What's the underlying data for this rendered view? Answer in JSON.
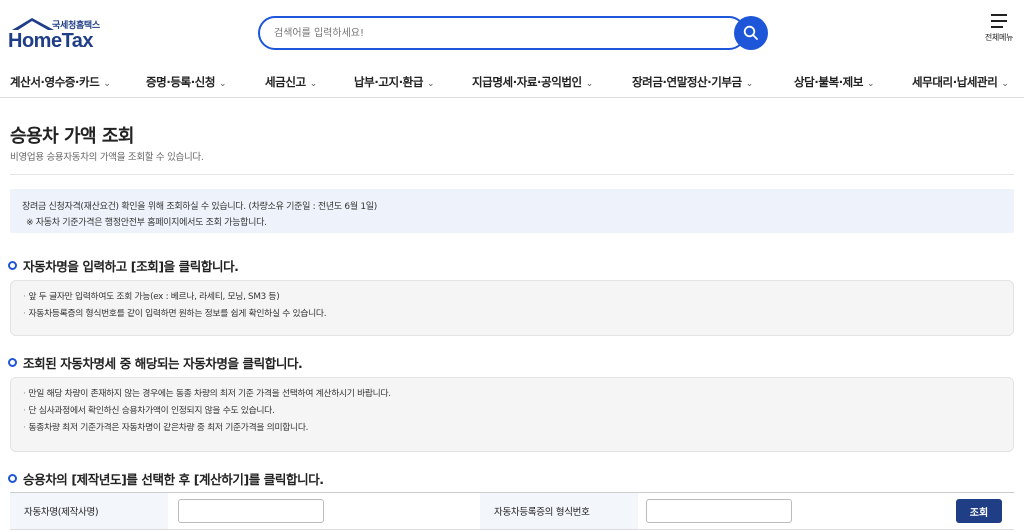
{
  "header": {
    "logo_sub": "국세청홈택스",
    "logo_main": "HomeTax",
    "search_placeholder": "검색어를 입력하세요!",
    "allmenu_label": "전체메뉴"
  },
  "nav": {
    "items": [
      {
        "label": "계산서·영수증·카드"
      },
      {
        "label": "증명·등록·신청"
      },
      {
        "label": "세금신고"
      },
      {
        "label": "납부·고지·환급"
      },
      {
        "label": "지급명세·자료·공익법인"
      },
      {
        "label": "장려금·연말정산·기부금"
      },
      {
        "label": "상담·불복·제보"
      },
      {
        "label": "세무대리·납세관리"
      }
    ]
  },
  "page": {
    "title": "승용차 가액 조회",
    "description": "비영업용 승용자동차의 가액을 조회할 수 있습니다."
  },
  "info": {
    "line1": "장려금 신청자격(재산요건) 확인을 위해 조회하실 수 있습니다. (차량소유 기준일 : 전년도 6월 1일)",
    "line2": "※ 자동차 기준가격은 행정안전부 홈페이지에서도 조회 가능합니다."
  },
  "sections": [
    {
      "title": "자동차명을 입력하고 [조회]을 클릭합니다.",
      "notes": [
        "앞 두 글자만 입력하여도 조회 가능(ex : 베르나, 라세티, 모닝, SM3 등)",
        "자동차등록증의 형식번호를 같이 입력하면 원하는 정보를 쉽게 확인하실 수 있습니다."
      ]
    },
    {
      "title": "조회된 자동차명세 중 해당되는 자동차명을 클릭합니다.",
      "notes": [
        "만일 해당 차량이 존재하지 않는 경우에는 동종 차량의 최저 기준 가격을 선택하여 계산하시기 바랍니다.",
        "단 심사과정에서 확인하신 승용차가액이 인정되지 않을 수도 있습니다.",
        "동종차량 최저 기준가격은 자동차명이 같은차량 중  최저 기준가격을 의미합니다."
      ]
    },
    {
      "title": "승용차의 [제작년도]를 선택한 후 [계산하기]를 클릭합니다."
    }
  ],
  "form": {
    "car_name_label": "자동차명(제작사명)",
    "car_name_value": "",
    "type_number_label": "자동차등록증의 형식번호",
    "type_number_value": "",
    "query_button": "조회"
  },
  "colors": {
    "brand_blue": "#1d56d8",
    "navy": "#1f3e86",
    "info_bg": "#eef3fb",
    "note_bg": "#f5f5f5"
  }
}
